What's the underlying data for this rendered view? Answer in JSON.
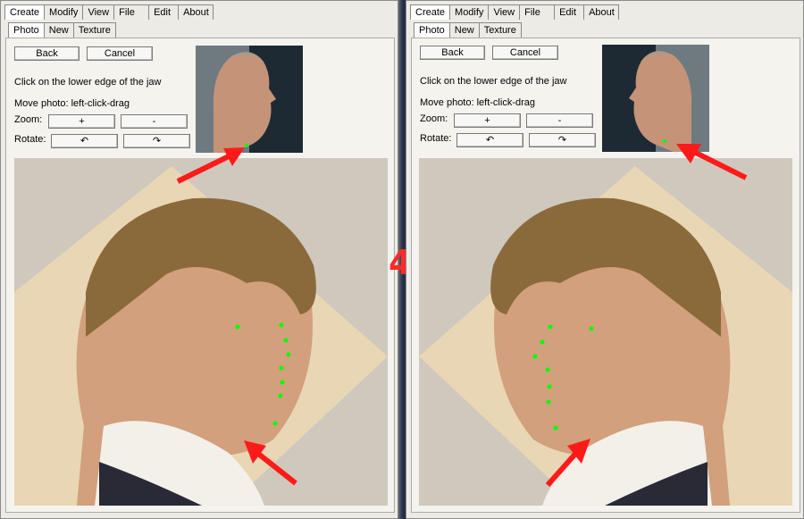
{
  "panels": [
    {
      "menu": [
        "Create",
        "Modify",
        "View",
        "File",
        "Edit",
        "About"
      ],
      "subtabs": [
        "Photo",
        "New",
        "Texture"
      ],
      "back": "Back",
      "cancel": "Cancel",
      "instruction": "Click on the lower edge of the jaw",
      "move": "Move photo: left-click-drag",
      "zoom_label": "Zoom:",
      "zoom_plus": "+",
      "zoom_minus": "-",
      "rotate_label": "Rotate:",
      "rotate_ccw": "↶",
      "rotate_cw": "↷"
    },
    {
      "menu": [
        "Create",
        "Modify",
        "View",
        "File",
        "Edit",
        "About"
      ],
      "subtabs": [
        "Photo",
        "New",
        "Texture"
      ],
      "back": "Back",
      "cancel": "Cancel",
      "instruction": "Click on the lower edge of the jaw",
      "move": "Move photo: left-click-drag",
      "zoom_label": "Zoom:",
      "zoom_plus": "+",
      "zoom_minus": "-",
      "rotate_label": "Rotate:",
      "rotate_ccw": "↶",
      "rotate_cw": "↷"
    }
  ],
  "step_number": "4",
  "colors": {
    "marker": "#00ff00",
    "arrow": "#ff1a1a"
  }
}
